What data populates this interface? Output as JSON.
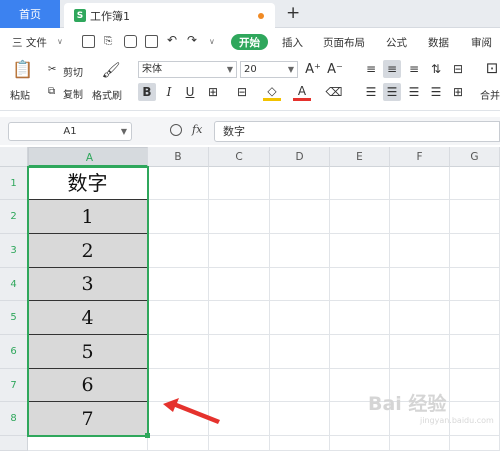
{
  "tabs": {
    "home": "首页",
    "doc_title": "工作簿1",
    "doc_icon": "S",
    "add": "+"
  },
  "menu": {
    "file": "三 文件",
    "start": "开始",
    "items": [
      "插入",
      "页面布局",
      "公式",
      "数据",
      "审阅"
    ]
  },
  "ribbon": {
    "paste": "粘贴",
    "cut": "剪切",
    "copy": "复制",
    "format_painter": "格式刷",
    "font_name": "宋体",
    "font_size": "20",
    "merge": "合并"
  },
  "formula": {
    "cell_ref": "A1",
    "fx": "fx",
    "content": "数字"
  },
  "grid": {
    "columns": [
      "A",
      "B",
      "C",
      "D",
      "E",
      "F",
      "G"
    ],
    "rows": [
      "1",
      "2",
      "3",
      "4",
      "5",
      "6",
      "7",
      "8"
    ],
    "a_values": [
      "数字",
      "1",
      "2",
      "3",
      "4",
      "5",
      "6",
      "7"
    ]
  },
  "watermark": {
    "brand": "Bai 经验",
    "url": "jingyan.baidu.com"
  },
  "colors": {
    "accent": "#2fa75c",
    "tab_blue": "#3c82f0",
    "arrow": "#e5322d"
  }
}
